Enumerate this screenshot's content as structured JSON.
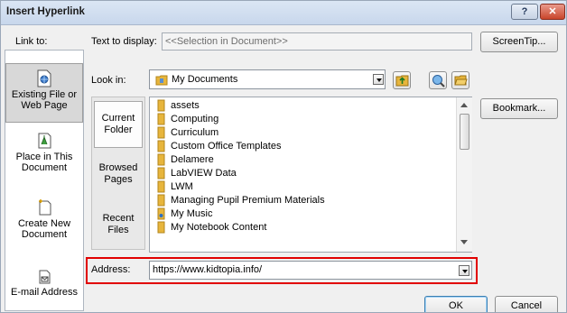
{
  "title": "Insert Hyperlink",
  "titlebar_buttons": {
    "help": "?",
    "close": "✕"
  },
  "link_to": {
    "label": "Link to:",
    "items": [
      {
        "label": "Existing File or Web Page",
        "icon": "existing-file-icon"
      },
      {
        "label": "Place in This Document",
        "icon": "place-in-document-icon"
      },
      {
        "label": "Create New Document",
        "icon": "create-new-document-icon"
      },
      {
        "label": "E-mail Address",
        "icon": "email-address-icon"
      }
    ]
  },
  "text_to_display": {
    "label": "Text to display:",
    "value": "<<Selection in Document>>"
  },
  "screentip_button": "ScreenTip...",
  "look_in": {
    "label": "Look in:",
    "value": "My Documents"
  },
  "bookmark_button": "Bookmark...",
  "places": [
    {
      "label": "Current Folder"
    },
    {
      "label": "Browsed Pages"
    },
    {
      "label": "Recent Files"
    }
  ],
  "files": [
    "assets",
    "Computing",
    "Curriculum",
    "Custom Office Templates",
    "Delamere",
    "LabVIEW Data",
    "LWM",
    "Managing Pupil Premium Materials",
    "My Music",
    "My Notebook Content"
  ],
  "address": {
    "label": "Address:",
    "value": "https://www.kidtopia.info/"
  },
  "ok_button": "OK",
  "cancel_button": "Cancel",
  "colors": {
    "highlight": "#e10000",
    "folder": "#e7b53c"
  }
}
